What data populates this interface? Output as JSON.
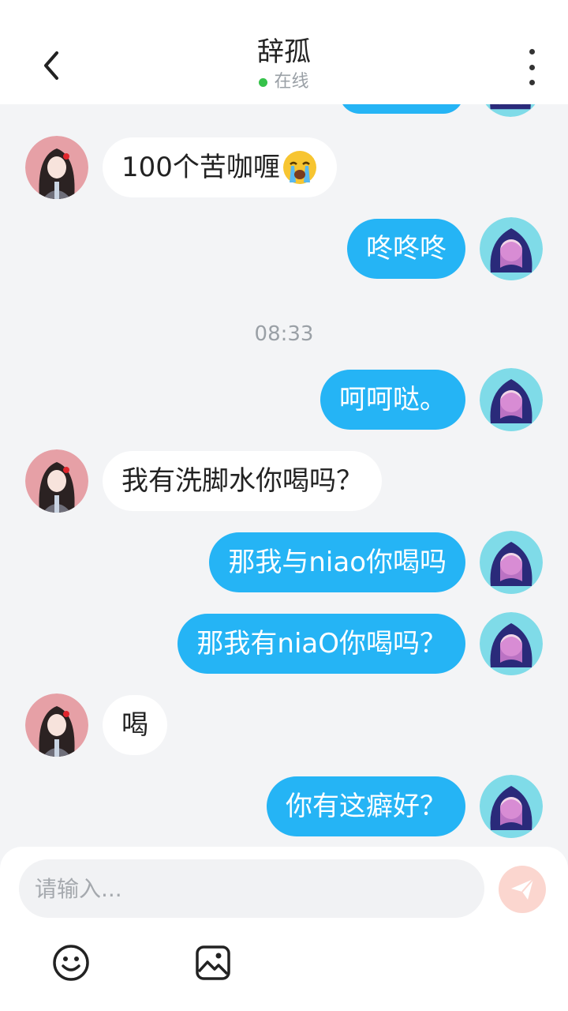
{
  "header": {
    "title": "辞孤",
    "status": "在线",
    "status_color": "#36c24a"
  },
  "colors": {
    "outgoing_bubble": "#25b4f5",
    "incoming_bubble": "#ffffff",
    "background": "#f3f4f6"
  },
  "messages": [
    {
      "side": "left",
      "text": "100个苦咖喱",
      "emoji": "loudly-crying-face"
    },
    {
      "side": "right",
      "text": "咚咚咚"
    },
    {
      "side": "right",
      "text": "呵呵哒。"
    },
    {
      "side": "left",
      "text": "我有洗脚水你喝吗？"
    },
    {
      "side": "right",
      "text": "那我与niao你喝吗"
    },
    {
      "side": "right",
      "text": "那我有niaO你喝吗？"
    },
    {
      "side": "left",
      "text": "喝"
    },
    {
      "side": "right",
      "text": "你有这癖好？"
    }
  ],
  "timestamp": "08:33",
  "composer": {
    "placeholder": "请输入...",
    "send_icon": "paper-plane-icon",
    "tools": [
      "emoji-icon",
      "image-icon"
    ]
  }
}
